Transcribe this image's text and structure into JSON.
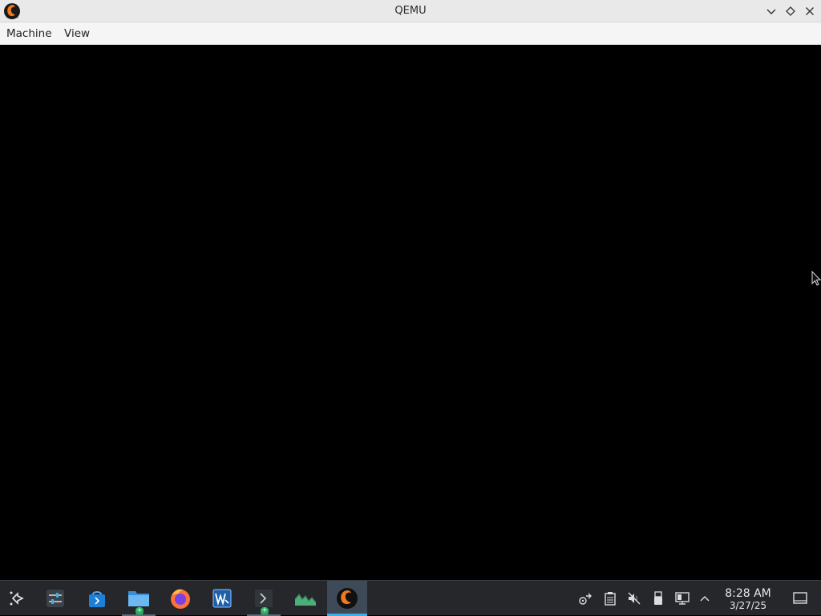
{
  "window": {
    "title": "QEMU",
    "controls": [
      "minimize",
      "maximize",
      "close"
    ]
  },
  "menubar": {
    "items": [
      "Machine",
      "View"
    ]
  },
  "taskbar": {
    "launcher": "application-launcher-icon",
    "apps": [
      {
        "name": "system-settings-icon",
        "state": "idle"
      },
      {
        "name": "discover-store-icon",
        "state": "idle"
      },
      {
        "name": "file-manager-icon",
        "state": "running"
      },
      {
        "name": "firefox-icon",
        "state": "idle"
      },
      {
        "name": "writer-icon",
        "state": "idle"
      },
      {
        "name": "terminal-icon",
        "state": "running"
      },
      {
        "name": "system-monitor-icon",
        "state": "idle"
      },
      {
        "name": "qemu-icon",
        "state": "active"
      }
    ],
    "tray": [
      "network-icon",
      "clipboard-icon",
      "volume-muted-icon",
      "usb-device-icon",
      "display-icon",
      "tray-expand-icon"
    ],
    "clock": {
      "time": "8:28 AM",
      "date": "3/27/25"
    },
    "show_desktop": "show-desktop-icon"
  },
  "colors": {
    "titlebar": "#e9e9ea",
    "menubar": "#f5f5f5",
    "screen": "#000000",
    "taskbar": "#25272b",
    "active_app": "#3e4a57",
    "accent": "#3daee9"
  }
}
